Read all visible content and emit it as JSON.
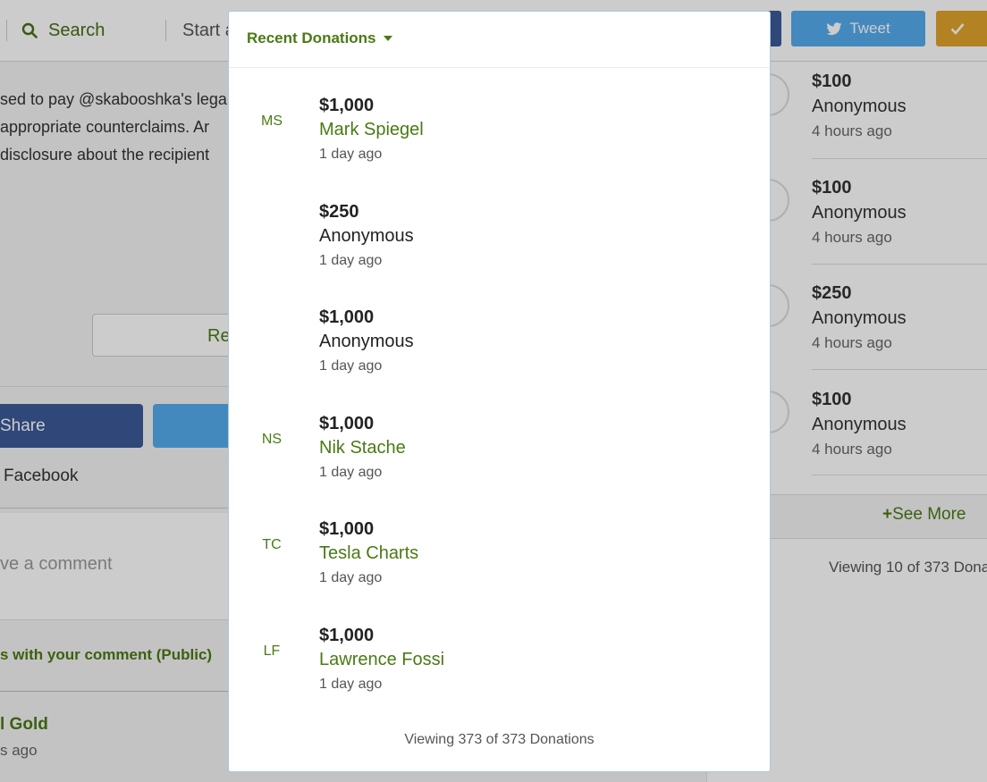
{
  "background": {
    "topbar": {
      "search_label": "Search",
      "start_label": "Start a",
      "tweet_label": "Tweet"
    },
    "story_lines": [
      "sed to pay @skabooshka's lega",
      "appropriate counterclaims. Ar",
      "disclosure about the recipient"
    ],
    "read_more_label": "Re",
    "share_label": "Share",
    "facebook_label": "Facebook",
    "comment_placeholder": "ve a comment",
    "comment_public_label": "s with your comment (Public)",
    "commenter": {
      "name": "l Gold",
      "time": "s ago"
    },
    "side": {
      "items": [
        {
          "amount": "$100",
          "name": "Anonymous",
          "time": "4 hours ago"
        },
        {
          "amount": "$100",
          "name": "Anonymous",
          "time": "4 hours ago"
        },
        {
          "amount": "$250",
          "name": "Anonymous",
          "time": "4 hours ago"
        },
        {
          "amount": "$100",
          "name": "Anonymous",
          "time": "4 hours ago"
        }
      ],
      "see_more_label": "See More",
      "viewing_label": "Viewing 10 of 373 Dona"
    }
  },
  "modal": {
    "title": "Recent Donations",
    "donations": [
      {
        "initials": "MS",
        "amount": "$1,000",
        "name": "Mark Spiegel",
        "time": "1 day ago",
        "named": true
      },
      {
        "initials": "",
        "amount": "$250",
        "name": "Anonymous",
        "time": "1 day ago",
        "named": false
      },
      {
        "initials": "",
        "amount": "$1,000",
        "name": "Anonymous",
        "time": "1 day ago",
        "named": false
      },
      {
        "initials": "NS",
        "amount": "$1,000",
        "name": "Nik Stache",
        "time": "1 day ago",
        "named": true
      },
      {
        "initials": "TC",
        "amount": "$1,000",
        "name": "Tesla Charts",
        "time": "1 day ago",
        "named": true
      },
      {
        "initials": "LF",
        "amount": "$1,000",
        "name": "Lawrence Fossi",
        "time": "1 day ago",
        "named": true
      }
    ],
    "footer": "Viewing 373 of 373 Donations"
  },
  "colors": {
    "accent_green": "#4a7a14",
    "facebook_blue": "#3b5998",
    "twitter_blue": "#55acee",
    "follow_gold": "#e0a32b"
  }
}
